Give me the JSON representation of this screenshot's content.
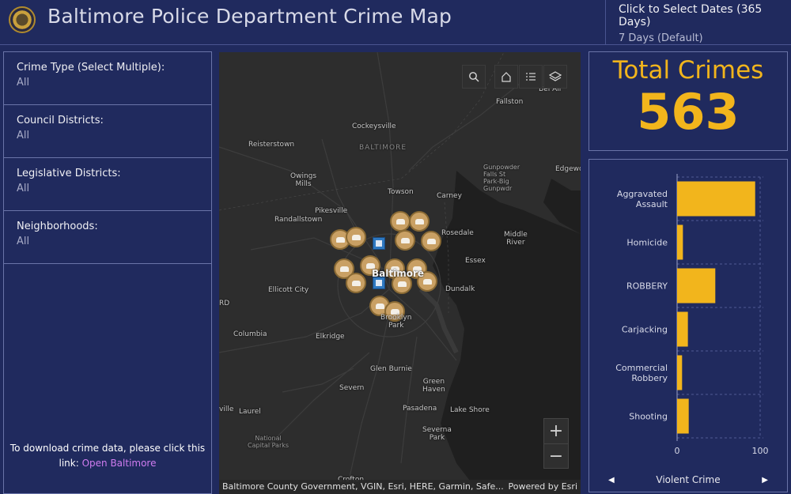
{
  "header": {
    "title": "Baltimore Police Department Crime Map",
    "date_label": "Click to Select Dates (365 Days)",
    "date_value": "7 Days (Default)"
  },
  "filters": [
    {
      "label": "Crime Type (Select Multiple):",
      "value": "All"
    },
    {
      "label": "Council Districts:",
      "value": "All"
    },
    {
      "label": "Legislative Districts:",
      "value": "All"
    },
    {
      "label": "Neighborhoods:",
      "value": "All"
    }
  ],
  "download": {
    "text": "To download crime data, please click this link:",
    "link_text": "Open Baltimore"
  },
  "map": {
    "labels": {
      "fallston": "Fallston",
      "cockeysville": "Cockeysville",
      "reisterstown": "Reisterstown",
      "baltimore_county": "BALTIMORE",
      "owings_mills": "Owings\nMills",
      "towson": "Towson",
      "carney": "Carney",
      "gunpowder": "Gunpowder\nFalls St\nPark-Big\nGunpwdr",
      "edgewood": "Edgewo",
      "pikesville": "Pikesville",
      "randallstown": "Randallstown",
      "rosedale": "Rosedale",
      "middle_river": "Middle\nRiver",
      "essex": "Essex",
      "baltimore": "Baltimore",
      "ellicott_city": "Ellicott City",
      "dundalk": "Dundalk",
      "brooklyn_park": "Brooklyn\nPark",
      "columbia": "Columbia",
      "elkridge": "Elkridge",
      "glen_burnie": "Glen Burnie",
      "severn": "Severn",
      "green_haven": "Green\nHaven",
      "laurel": "Laurel",
      "pasadena": "Pasadena",
      "lake_shore": "Lake Shore",
      "severna_park": "Severna\nPark",
      "national_capital_parks": "National\nCapital Parks",
      "crofton": "Crofton",
      "ville": "ville",
      "rd": "RD",
      "bel_air": "Bel Air"
    },
    "attribution": "Baltimore County Government, VGIN, Esri, HERE, Garmin, Safe...",
    "powered_by": "Powered by Esri",
    "zoom_in": "+",
    "zoom_out": "−",
    "tools": [
      "search-icon",
      "home-icon",
      "list-icon",
      "layers-icon"
    ]
  },
  "total": {
    "title": "Total Crimes",
    "value": "563"
  },
  "chart_data": {
    "type": "bar",
    "orientation": "horizontal",
    "title": "Violent Crime",
    "categories": [
      "Aggravated Assault",
      "Homicide",
      "ROBBERY",
      "Carjacking",
      "Commercial Robbery",
      "Shooting"
    ],
    "category_lines": [
      [
        "Aggravated",
        "Assault"
      ],
      [
        "Homicide"
      ],
      [
        "ROBBERY"
      ],
      [
        "Carjacking"
      ],
      [
        "Commercial",
        "Robbery"
      ],
      [
        "Shooting"
      ]
    ],
    "values": [
      94,
      7,
      46,
      13,
      6,
      14
    ],
    "xlim": [
      0,
      100
    ],
    "ticks": [
      "0",
      "100"
    ],
    "bar_color": "#f2b51c",
    "grid": true
  },
  "colors": {
    "background": "#202a5e",
    "accent": "#f2b51c",
    "link": "#d07cf0"
  }
}
